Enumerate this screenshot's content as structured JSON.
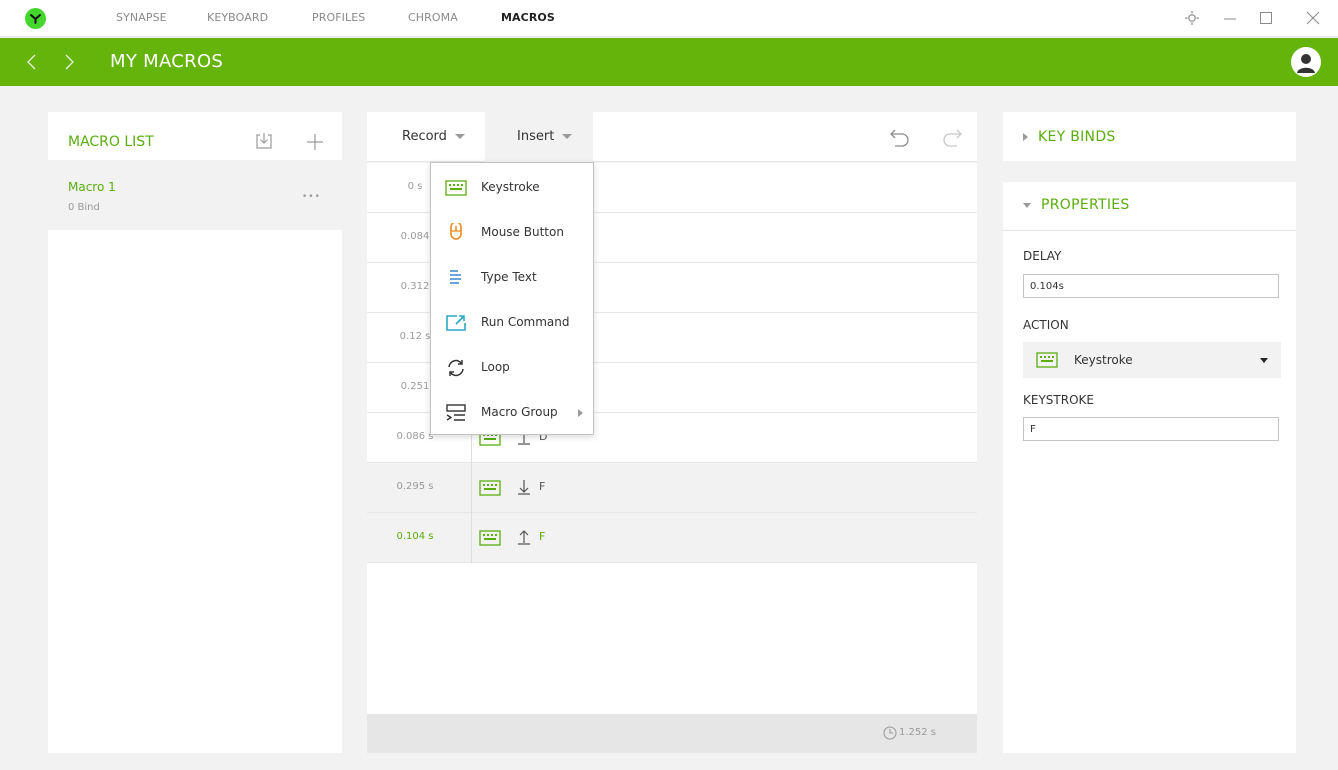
{
  "nav": {
    "items": [
      "SYNAPSE",
      "KEYBOARD",
      "PROFILES",
      "CHROMA",
      "MACROS"
    ],
    "active": "MACROS"
  },
  "header": {
    "title": "MY MACROS"
  },
  "macro_list": {
    "title": "MACRO LIST",
    "items": [
      {
        "name": "Macro 1",
        "binds": "0 Bind",
        "more": "•••"
      }
    ]
  },
  "editor": {
    "record_label": "Record",
    "insert_label": "Insert",
    "rows": [
      {
        "delay": "0 s",
        "direction": "down",
        "key": ""
      },
      {
        "delay": "0.084",
        "direction": "up",
        "key": ""
      },
      {
        "delay": "0.312",
        "direction": "down",
        "key": ""
      },
      {
        "delay": "0.12 s",
        "direction": "up",
        "key": ""
      },
      {
        "delay": "0.251",
        "direction": "down",
        "key": ""
      },
      {
        "delay": "0.086 s",
        "direction": "up",
        "key": "D"
      },
      {
        "delay": "0.295 s",
        "direction": "down",
        "key": "F"
      },
      {
        "delay": "0.104 s",
        "direction": "up",
        "key": "F"
      }
    ],
    "total_time": "1.252 s"
  },
  "insert_menu": {
    "items": [
      "Keystroke",
      "Mouse Button",
      "Type Text",
      "Run Command",
      "Loop",
      "Macro Group"
    ]
  },
  "key_binds": {
    "title": "KEY BINDS"
  },
  "properties": {
    "title": "PROPERTIES",
    "delay_label": "DELAY",
    "delay_value": "0.104s",
    "action_label": "ACTION",
    "action_value": "Keystroke",
    "keystroke_label": "KEYSTROKE",
    "keystroke_value": "F"
  },
  "colors": {
    "accent": "#65b40c",
    "accent_text": "#5aad0d",
    "orange": "#f08c1e",
    "blue": "#3a86d0",
    "teal": "#2aa7c6"
  }
}
